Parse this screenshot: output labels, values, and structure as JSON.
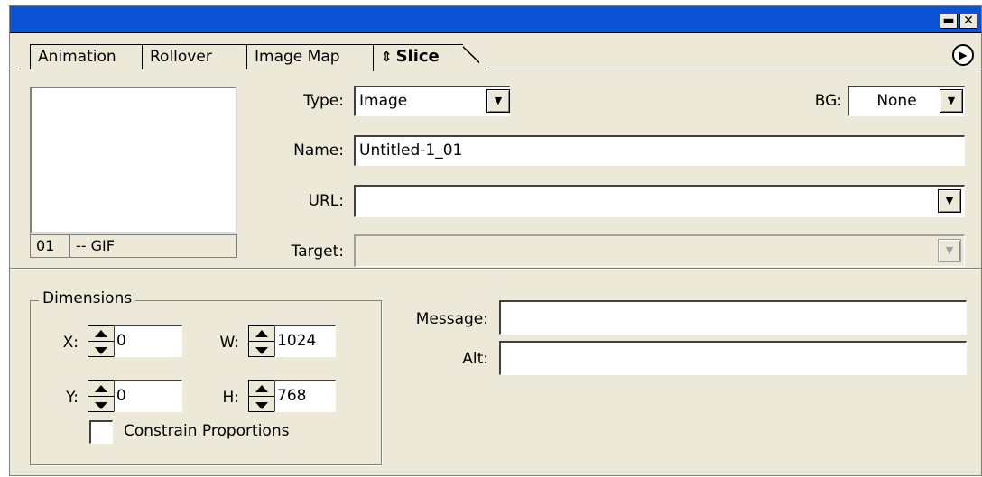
{
  "title_bar": {
    "minimize": "▬",
    "close": "✕"
  },
  "tabs": [
    {
      "label": "Animation"
    },
    {
      "label": "Rollover"
    },
    {
      "label": "Image Map"
    },
    {
      "label": "Slice",
      "prefix": "⇕",
      "active": true
    }
  ],
  "panel_menu_icon": "▶",
  "preview": {
    "number": "01",
    "format": "-- GIF"
  },
  "slice": {
    "type_label": "Type:",
    "type_value": "Image",
    "bg_label": "BG:",
    "bg_value": "None",
    "name_label": "Name:",
    "name_value": "Untitled-1_01",
    "url_label": "URL:",
    "url_value": "",
    "target_label": "Target:",
    "target_value": ""
  },
  "dimensions": {
    "group_label": "Dimensions",
    "x_label": "X:",
    "x_value": "0",
    "y_label": "Y:",
    "y_value": "0",
    "w_label": "W:",
    "w_value": "1024",
    "h_label": "H:",
    "h_value": "768",
    "constrain_label": "Constrain Proportions",
    "constrain_checked": false
  },
  "message_label": "Message:",
  "message_value": "",
  "alt_label": "Alt:",
  "alt_value": "",
  "colors": {
    "titlebar": "#0a53d6",
    "panel": "#ece9d8"
  }
}
